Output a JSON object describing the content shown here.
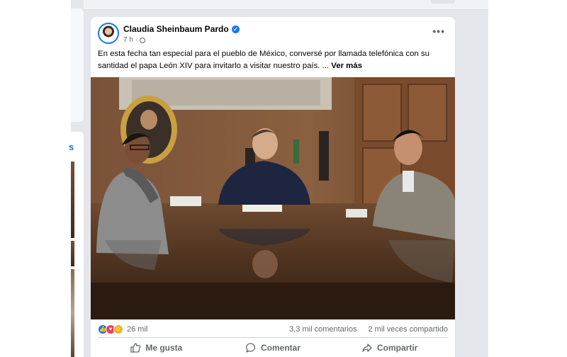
{
  "post": {
    "author": "Claudia Sheinbaum Pardo",
    "time": "7 h",
    "separator": "·",
    "caption": "En esta fecha tan especial para el pueblo de México, conversé por llamada telefónica con su santidad el papa León XIV para invitarlo a visitar nuestro país. ...",
    "see_more": "Ver más",
    "more_icon": "•••",
    "verified_icon": "✓"
  },
  "stats": {
    "reactions_count": "26 mil",
    "comments": "3,3 mil comentarios",
    "shares": "2 mil veces compartido",
    "reaction_icons": [
      "like-icon",
      "love-icon",
      "care-icon"
    ]
  },
  "actions": {
    "like": "Me gusta",
    "comment": "Comentar",
    "share": "Compartir"
  },
  "left_column": {
    "partial_label": "s"
  },
  "colors": {
    "brand_blue": "#1877f2",
    "text_primary": "#050505",
    "text_secondary": "#65676b",
    "feed_bg": "#e4e6eb"
  }
}
